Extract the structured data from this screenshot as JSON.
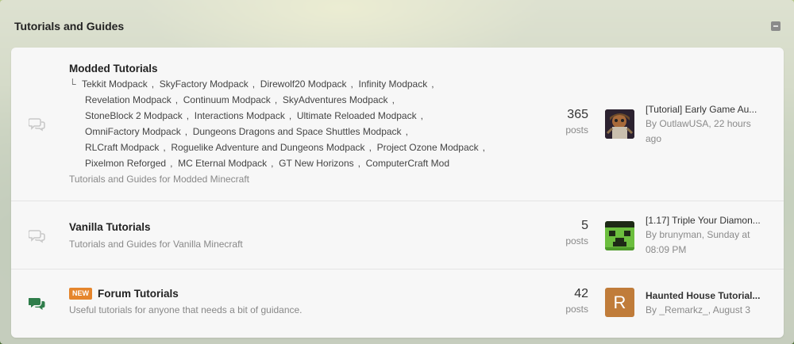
{
  "category": {
    "title": "Tutorials and Guides"
  },
  "forums": [
    {
      "title": "Modded Tutorials",
      "subforums_lines": [
        [
          "Tekkit Modpack",
          "SkyFactory Modpack",
          "Direwolf20 Modpack",
          "Infinity Modpack"
        ],
        [
          "Revelation Modpack",
          "Continuum Modpack",
          "SkyAdventures Modpack"
        ],
        [
          "StoneBlock 2 Modpack",
          "Interactions Modpack",
          "Ultimate Reloaded Modpack"
        ],
        [
          "OmniFactory Modpack",
          "Dungeons Dragons and Space Shuttles Modpack"
        ],
        [
          "RLCraft Modpack",
          "Roguelike Adventure and Dungeons Modpack",
          "Project Ozone Modpack"
        ],
        [
          "Pixelmon Reforged",
          "MC Eternal Modpack",
          "GT New Horizons",
          "ComputerCraft Mod"
        ]
      ],
      "description": "Tutorials and Guides for Modded Minecraft",
      "count": "365",
      "count_label": "posts",
      "last_post": {
        "title": "[Tutorial] Early Game Au...",
        "meta_line1": "By OutlawUSA, 22 hours",
        "meta_line2": "ago"
      }
    },
    {
      "title": "Vanilla Tutorials",
      "description": "Tutorials and Guides for Vanilla Minecraft",
      "count": "5",
      "count_label": "posts",
      "last_post": {
        "title": "[1.17] Triple Your Diamon...",
        "meta_line1": "By brunyman, Sunday at",
        "meta_line2": "08:09 PM"
      }
    },
    {
      "badge": "NEW",
      "title": "Forum Tutorials",
      "description": "Useful tutorials for anyone that needs a bit of guidance.",
      "count": "42",
      "count_label": "posts",
      "last_post": {
        "title": "Haunted House Tutorial...",
        "meta_line1": "By _Remarkz_, August 3",
        "avatar_letter": "R"
      }
    }
  ],
  "colors": {
    "read_icon": "#c8c8c8",
    "unread_icon": "#2f7d4a",
    "badge": "#e5852c",
    "avatar_letter_bg": "#c07c3a"
  }
}
